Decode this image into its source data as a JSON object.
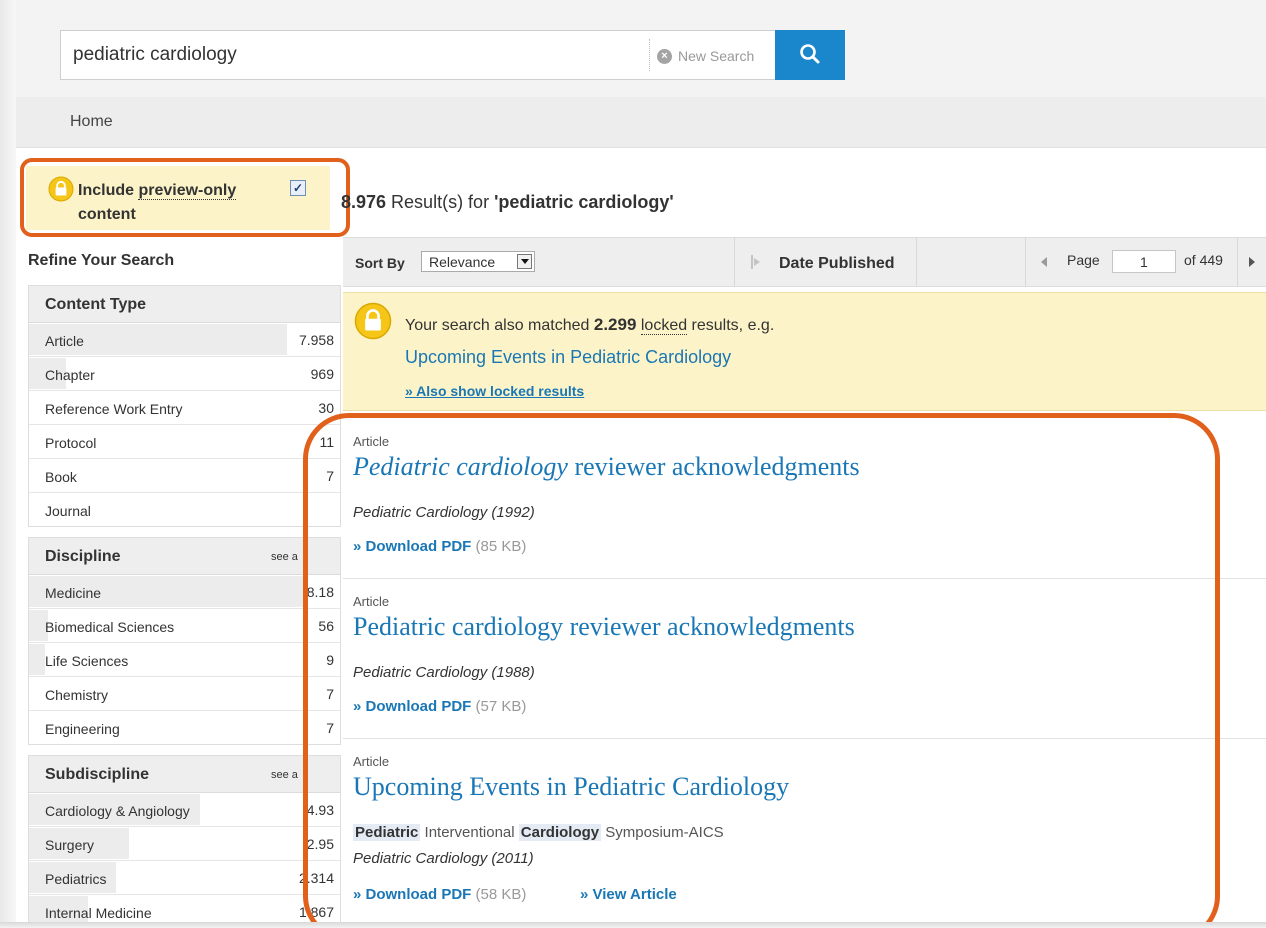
{
  "search": {
    "query": "pediatric cardiology",
    "new_search_label": "New Search"
  },
  "nav": {
    "home": "Home"
  },
  "preview": {
    "label_prefix": "Include ",
    "label_link": "preview-only",
    "label_suffix": "content",
    "checked_mark": "✓"
  },
  "sidebar": {
    "title": "Refine Your Search",
    "facets": [
      {
        "title": "Content Type",
        "see_all": "",
        "items": [
          {
            "label": "Article",
            "count": "7.958",
            "fraction": 0.83
          },
          {
            "label": "Chapter",
            "count": "969",
            "fraction": 0.12
          },
          {
            "label": "Reference Work Entry",
            "count": "30",
            "fraction": 0.0
          },
          {
            "label": "Protocol",
            "count": "11",
            "fraction": 0.0
          },
          {
            "label": "Book",
            "count": "7",
            "fraction": 0.0
          },
          {
            "label": "Journal",
            "count": "",
            "fraction": 0.0
          }
        ]
      },
      {
        "title": "Discipline",
        "see_all": "see a",
        "items": [
          {
            "label": "Medicine",
            "count": "8.18",
            "fraction": 0.88
          },
          {
            "label": "Biomedical Sciences",
            "count": "56",
            "fraction": 0.06
          },
          {
            "label": "Life Sciences",
            "count": "9",
            "fraction": 0.05
          },
          {
            "label": "Chemistry",
            "count": "7",
            "fraction": 0.0
          },
          {
            "label": "Engineering",
            "count": "7",
            "fraction": 0.0
          }
        ]
      },
      {
        "title": "Subdiscipline",
        "see_all": "see a",
        "items": [
          {
            "label": "Cardiology & Angiology",
            "count": "4.93",
            "fraction": 0.55
          },
          {
            "label": "Surgery",
            "count": "2.95",
            "fraction": 0.32
          },
          {
            "label": "Pediatrics",
            "count": "2.314",
            "fraction": 0.28
          },
          {
            "label": "Internal Medicine",
            "count": "1.867",
            "fraction": 0.19
          }
        ]
      }
    ]
  },
  "results_header": {
    "count": "8.976",
    "text_mid": " Result(s) for ",
    "query_quoted": "'pediatric cardiology'"
  },
  "sortbar": {
    "sort_by_label": "Sort By",
    "sort_value": "Relevance",
    "date_published_label": "Date Published",
    "page_label": "Page",
    "page_value": "1",
    "page_of": "of 449"
  },
  "locked": {
    "text_prefix": "Your search also matched ",
    "count": "2.299",
    "locked_word": "locked",
    "text_suffix": " results, e.g.",
    "example_link": "Upcoming Events in Pediatric Cardiology",
    "show_locked": "» Also show locked results"
  },
  "results": [
    {
      "type": "Article",
      "title_italic": "Pediatric cardiology",
      "title_rest": " reviewer acknowledgments",
      "journal": "Pediatric Cardiology (1992)",
      "pdf_label": "» Download PDF",
      "pdf_size": " (85 KB)"
    },
    {
      "type": "Article",
      "title_italic": "",
      "title_rest": "Pediatric cardiology reviewer acknowledgments",
      "journal": "Pediatric Cardiology (1988)",
      "pdf_label": "» Download PDF",
      "pdf_size": " (57 KB)"
    },
    {
      "type": "Article",
      "title_italic": "",
      "title_rest": "Upcoming Events in Pediatric Cardiology",
      "snippet_hl1": "Pediatric",
      "snippet_mid": " Interventional ",
      "snippet_hl2": "Cardiology",
      "snippet_end": " Symposium-AICS",
      "journal": "Pediatric Cardiology (2011)",
      "pdf_label": "» Download PDF",
      "pdf_size": " (58 KB)",
      "view_label": "» View Article"
    }
  ],
  "colors": {
    "accent_blue": "#1a86cc",
    "link_blue": "#1a77b5",
    "highlight_orange": "#e0601c",
    "notice_yellow": "#fcf4c8"
  }
}
